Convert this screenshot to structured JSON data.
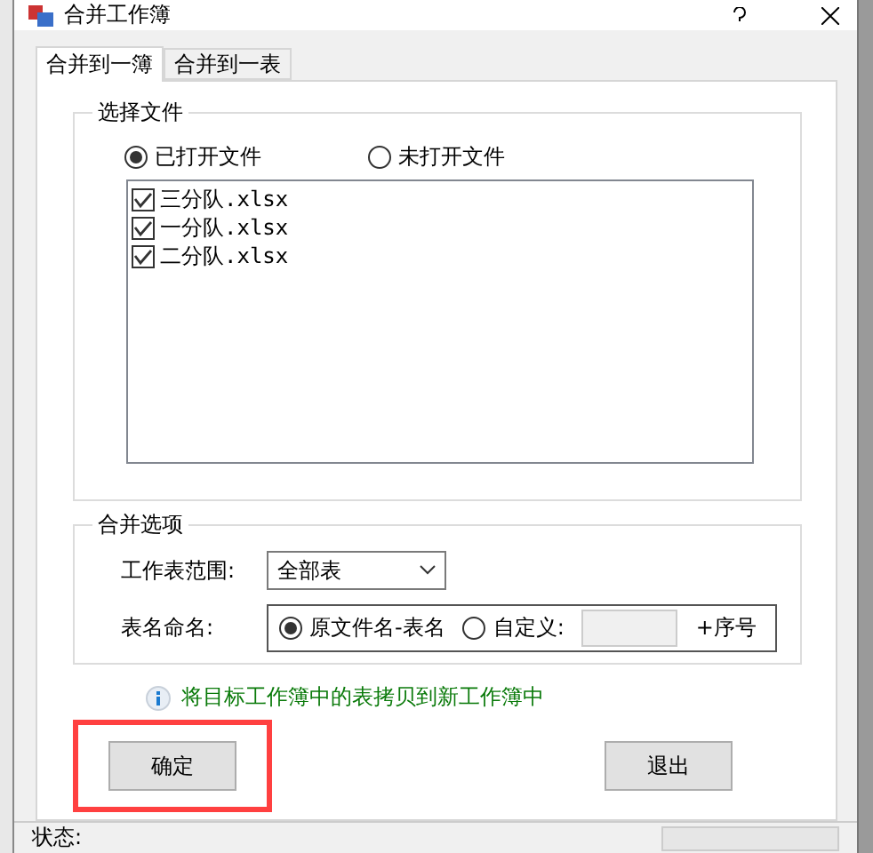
{
  "window": {
    "title": "合并工作簿"
  },
  "tabs": [
    {
      "label": "合并到一簿",
      "selected": true
    },
    {
      "label": "合并到一表",
      "selected": false
    }
  ],
  "file_group": {
    "title": "选择文件",
    "sources": [
      {
        "label": "已打开文件",
        "selected": true
      },
      {
        "label": "未打开文件",
        "selected": false
      }
    ],
    "files": [
      {
        "name": "三分队.xlsx",
        "checked": true
      },
      {
        "name": "一分队.xlsx",
        "checked": true
      },
      {
        "name": "二分队.xlsx",
        "checked": true
      }
    ]
  },
  "options_group": {
    "title": "合并选项",
    "range_label": "工作表范围:",
    "range_value": "全部表",
    "naming_label": "表名命名:",
    "naming": [
      {
        "label": "原文件名-表名",
        "selected": true
      },
      {
        "label": "自定义:",
        "selected": false
      }
    ],
    "suffix": "+序号"
  },
  "info": "将目标工作簿中的表拷贝到新工作簿中",
  "buttons": [
    {
      "label": "确定",
      "highlighted": true
    },
    {
      "label": "退出",
      "highlighted": false
    }
  ],
  "status_bar": {
    "label": "状态:"
  }
}
